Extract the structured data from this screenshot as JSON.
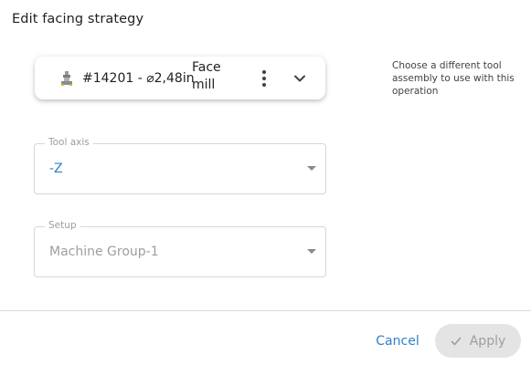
{
  "dialog": {
    "title": "Edit facing strategy"
  },
  "tool": {
    "label": "#14201 - ⌀2,48in",
    "type": "Face mill",
    "icon": "tool-assembly-icon",
    "menu_icon": "more-vert-icon",
    "expand_icon": "chevron-down-icon",
    "help": "Choose a different tool assembly to use with this operation"
  },
  "tool_axis": {
    "legend": "Tool axis",
    "value": "-Z"
  },
  "setup": {
    "legend": "Setup",
    "value": "Machine Group-1"
  },
  "actions": {
    "cancel": "Cancel",
    "apply": "Apply"
  },
  "colors": {
    "accent": "#2f80c8",
    "disabled_text": "#9e9e9e",
    "disabled_button": "#e4e4e4"
  }
}
